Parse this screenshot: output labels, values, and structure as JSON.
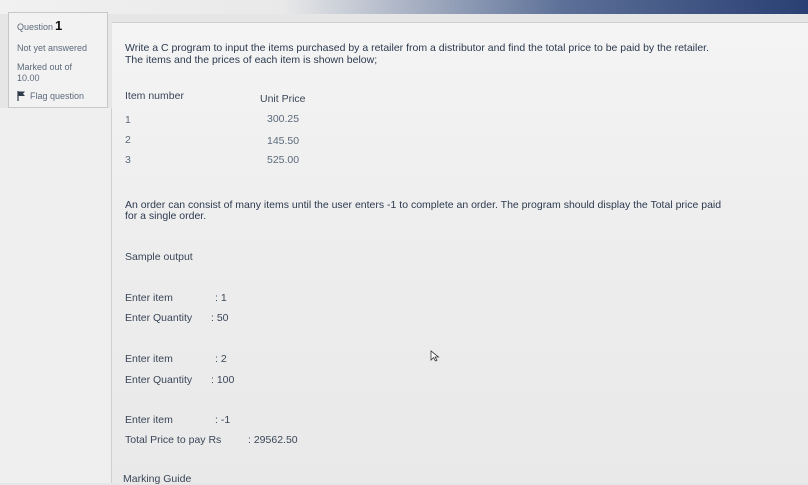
{
  "info": {
    "question_label": "Question",
    "question_number": "1",
    "status": "Not yet answered",
    "marked_label": "Marked out of",
    "marked_value": "10.00",
    "flag_label": "Flag question"
  },
  "question": {
    "line1": "Write a C program to input the items purchased by a retailer from a distributor and find the total price to be paid by the retailer.",
    "line2": "The items and the prices of each item is shown below;",
    "table": {
      "headers": [
        "Item number",
        "Unit Price"
      ],
      "rows": [
        [
          "1",
          "300.25"
        ],
        [
          "2",
          "145.50"
        ],
        [
          "3",
          "525.00"
        ]
      ]
    },
    "para_line1": "An order can consist of many items until the user enters -1 to complete an order.  The program should display the Total price paid",
    "para_line2": "for a single order.",
    "sample_title": "Sample output",
    "sample": [
      {
        "label": "Enter item",
        "value": ": 1"
      },
      {
        "label": "Enter Quantity",
        "value": ": 50"
      },
      {
        "label": "Enter item",
        "value": ": 2"
      },
      {
        "label": "Enter Quantity",
        "value": ": 100"
      },
      {
        "label": "Enter item",
        "value": ": -1"
      },
      {
        "label": "Total Price to pay Rs",
        "value": ":  29562.50"
      }
    ],
    "marking_guide": "Marking Guide"
  },
  "icons": {
    "flag": "flag-icon",
    "cursor": "mouse-pointer-icon"
  }
}
